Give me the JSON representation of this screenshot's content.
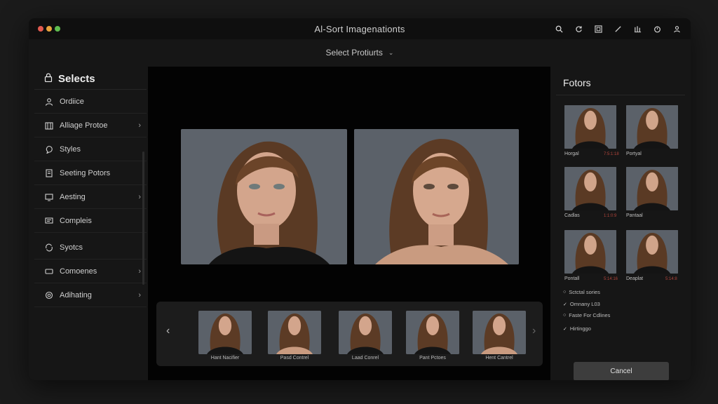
{
  "window": {
    "title": "Al-Sort Imagenationts",
    "traffic_colors": [
      "#e25a4f",
      "#e8a33d",
      "#5fbd50"
    ]
  },
  "toolbar_icons": [
    "search-icon",
    "refresh-icon",
    "grid-icon",
    "pen-icon",
    "bars-icon",
    "timer-icon",
    "user-icon"
  ],
  "selector": {
    "label": "Select Protiurts"
  },
  "sidebar": {
    "title": "Selects",
    "items": [
      {
        "label": "Ordiice",
        "icon": "person-icon",
        "arrow": false
      },
      {
        "label": "Alliage Protoe",
        "icon": "gallery-icon",
        "arrow": true
      },
      {
        "label": "Styles",
        "icon": "bubble-icon",
        "arrow": false
      },
      {
        "label": "Seeting Potors",
        "icon": "document-icon",
        "arrow": false
      },
      {
        "label": "Aesting",
        "icon": "screen-icon",
        "arrow": true
      },
      {
        "label": "Compleis",
        "icon": "message-icon",
        "arrow": false
      },
      {
        "label": "Syotcs",
        "icon": "sync-icon",
        "arrow": false
      },
      {
        "label": "Comoenes",
        "icon": "rectangle-icon",
        "arrow": true
      },
      {
        "label": "Adihating",
        "icon": "badge-icon",
        "arrow": true
      }
    ]
  },
  "viewer": {
    "photos": [
      "portrait-left",
      "portrait-right"
    ]
  },
  "filmstrip": {
    "items": [
      {
        "caption": "Hant Nacifier"
      },
      {
        "caption": "Pasd Contrel"
      },
      {
        "caption": "Laad Conrel"
      },
      {
        "caption": "Pant Pctoes"
      },
      {
        "caption": "Hent Cantrel"
      }
    ]
  },
  "right_panel": {
    "title": "Fotors",
    "grid": [
      {
        "caption": "Horgal",
        "tag": "7:5:1:18"
      },
      {
        "caption": "Portyal",
        "tag": ""
      },
      {
        "caption": "Cadlas",
        "tag": "1:1:0:9"
      },
      {
        "caption": "Pantaal",
        "tag": ""
      },
      {
        "caption": "Pontall",
        "tag": "5:14:16"
      },
      {
        "caption": "Deaplat",
        "tag": "5:14:8"
      }
    ],
    "options": [
      {
        "label": "Sctctal sories",
        "mark": "○"
      },
      {
        "label": "Omnany L03",
        "mark": "✓"
      },
      {
        "label": "Faste For Cdlines",
        "mark": "○"
      }
    ],
    "checkbox": {
      "label": "Hirtinggo",
      "mark": "✓"
    },
    "cancel_label": "Cancel"
  },
  "colors": {
    "accent_red": "#b0443a",
    "panel": "#161616",
    "viewer": "#030303"
  }
}
